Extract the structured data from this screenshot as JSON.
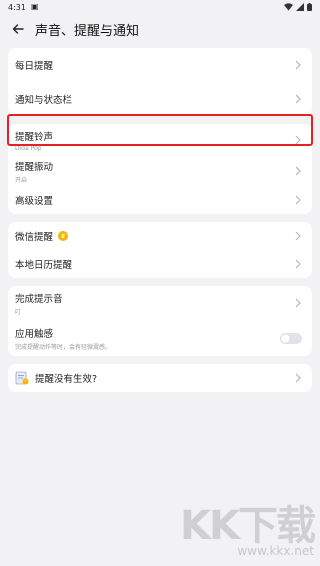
{
  "status_bar": {
    "time": "4:31"
  },
  "header": {
    "title": "声音、提醒与通知"
  },
  "group1": {
    "daily_reminder": "每日提醒",
    "notification_status_bar": "通知与状态栏"
  },
  "group2": {
    "ringtone_label": "提醒铃声",
    "ringtone_value": "Dida Pop",
    "vibration_label": "提醒振动",
    "vibration_value": "开启",
    "advanced_label": "高级设置"
  },
  "group3": {
    "wechat_label": "微信提醒",
    "calendar_label": "本地日历提醒"
  },
  "group4": {
    "completion_label": "完成提示音",
    "completion_value": "叮",
    "haptics_label": "应用触感",
    "haptics_desc": "完成提醒动作等时，会有轻微震感。",
    "haptics_on": false
  },
  "group5": {
    "help_label": "提醒没有生效?"
  },
  "watermark": {
    "big": "KK下载",
    "small": "www.kkx.net"
  },
  "colors": {
    "highlight": "#e32222",
    "crown": "#f4b400",
    "background": "#f2f2f4"
  }
}
